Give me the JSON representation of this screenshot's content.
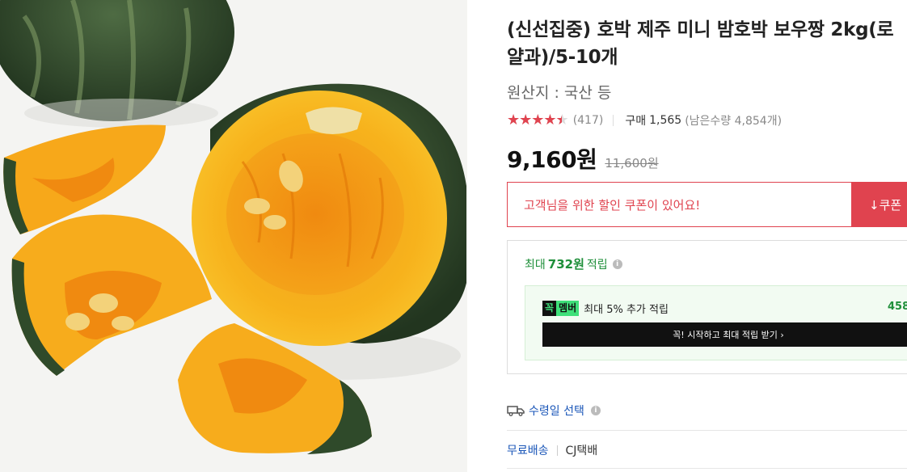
{
  "product": {
    "title": "(신선집중) 호박 제주 미니 밤호박 보우짱 2kg(로얄과)/5-10개",
    "origin": "원산지 : 국산 등",
    "image_alt": "밤호박 단면 사진"
  },
  "rating": {
    "stars_text": "★★★★★",
    "score_fraction": 0.9,
    "review_count": "(417)",
    "purchase_label": "구매",
    "purchase_count": "1,565",
    "stock_text": "(남은수량 4,854개)"
  },
  "price": {
    "sale": "9,160원",
    "original": "11,600원"
  },
  "coupon": {
    "message": "고객님을 위한 할인 쿠폰이 있어요!",
    "button_label": "↓쿠폰"
  },
  "points": {
    "prefix": "최대",
    "amount": "732원",
    "suffix": "적립",
    "info_icon": "i"
  },
  "membership": {
    "badge_part1": "꼭",
    "badge_part2": "멤버",
    "text": "최대 5% 추가 적립",
    "amount": "458",
    "cta": "꼭! 시작하고 최대 적립 받기 ›"
  },
  "delivery": {
    "date_label": "수령일 선택",
    "info_icon": "i",
    "free_shipping": "무료배송",
    "carrier": "CJ택배"
  },
  "colors": {
    "accent_red": "#e0434f",
    "points_green": "#1f8f3a",
    "link_blue": "#1a56b8"
  },
  "icons": [
    "star-icon",
    "info-icon",
    "truck-icon",
    "download-arrow-icon"
  ]
}
